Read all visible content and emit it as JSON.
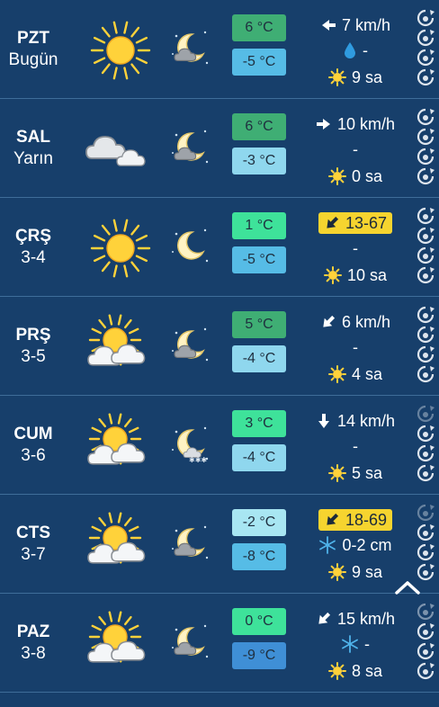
{
  "rows": [
    {
      "day": "PZT",
      "date": "Bugün",
      "day_icon": "sun-icon",
      "night_icon": "moon-cloud-icon",
      "max": "6 °C",
      "min": "-5 °C",
      "max_color": "#3fae74",
      "min_color": "#56bce6",
      "wind": "7 km/h",
      "wind_arrow": "arrow-left-icon",
      "precip": "-",
      "precip_icon": "raindrop-icon",
      "sun": "9 sa"
    },
    {
      "day": "SAL",
      "date": "Yarın",
      "day_icon": "clouds-icon",
      "night_icon": "moon-cloud-icon",
      "max": "6 °C",
      "min": "-3 °C",
      "max_color": "#3fae74",
      "min_color": "#8fd7ee",
      "wind": "10 km/h",
      "wind_arrow": "arrow-right-icon",
      "precip": "-",
      "precip_icon": "",
      "sun": "0 sa"
    },
    {
      "day": "ÇRŞ",
      "date": "3-4",
      "day_icon": "sun-icon",
      "night_icon": "moon-icon",
      "max": "1 °C",
      "min": "-5 °C",
      "max_color": "#3ee29a",
      "min_color": "#56bce6",
      "wind": "13-67",
      "wind_arrow": "arrow-down-left-icon",
      "gust": true,
      "precip": "-",
      "precip_icon": "",
      "sun": "10 sa"
    },
    {
      "day": "PRŞ",
      "date": "3-5",
      "day_icon": "sun-cloud-icon",
      "night_icon": "moon-cloud-icon",
      "max": "5 °C",
      "min": "-4 °C",
      "max_color": "#3fae74",
      "min_color": "#8fd7ee",
      "wind": "6 km/h",
      "wind_arrow": "arrow-down-left-icon",
      "precip": "-",
      "precip_icon": "",
      "sun": "4 sa"
    },
    {
      "day": "CUM",
      "date": "3-6",
      "day_icon": "sun-cloud-icon",
      "night_icon": "moon-snow-icon",
      "max": "3 °C",
      "min": "-4 °C",
      "max_color": "#3ee29a",
      "min_color": "#8fd7ee",
      "wind": "14 km/h",
      "wind_arrow": "arrow-down-icon",
      "precip": "-",
      "precip_icon": "",
      "sun": "5 sa"
    },
    {
      "day": "CTS",
      "date": "3-7",
      "day_icon": "sun-cloud-icon",
      "night_icon": "moon-cloud-icon",
      "max": "-2 °C",
      "min": "-8 °C",
      "max_color": "#a8e6f2",
      "min_color": "#56bce6",
      "wind": "18-69",
      "wind_arrow": "arrow-down-left-icon",
      "gust": true,
      "precip": "0-2 cm",
      "precip_icon": "snowflake-icon",
      "sun": "9 sa"
    },
    {
      "day": "PAZ",
      "date": "3-8",
      "day_icon": "sun-cloud-icon",
      "night_icon": "moon-cloud-icon",
      "max": "0 °C",
      "min": "-9 °C",
      "max_color": "#3ee29a",
      "min_color": "#3f8fd6",
      "wind": "15 km/h",
      "wind_arrow": "arrow-down-left-icon",
      "precip": "-",
      "precip_icon": "snowflake-icon",
      "sun": "8 sa"
    }
  ],
  "colors": {
    "background": "#173f6b",
    "divider": "#3f6d99",
    "gust_badge": "#f6d42f",
    "sun": "#ffd23a"
  },
  "scroll_top_icon": "chevron-up-icon"
}
